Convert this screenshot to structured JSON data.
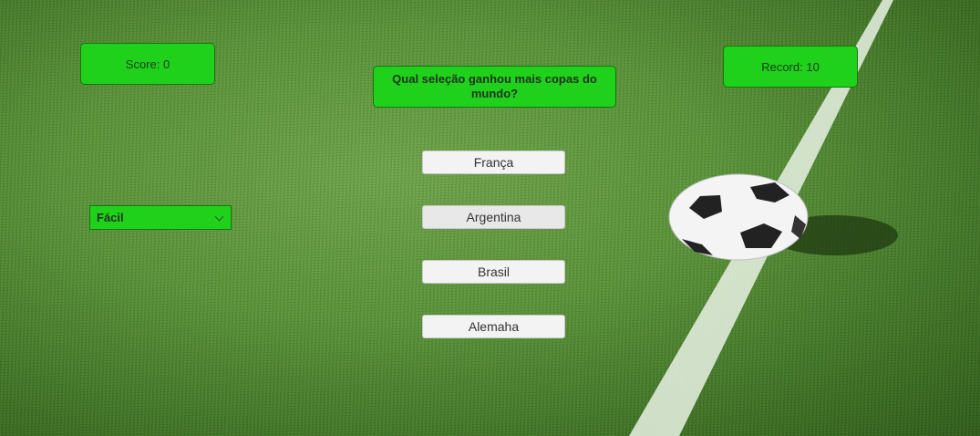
{
  "score_label": "Score: 0",
  "record_label": "Record: 10",
  "question": "Qual seleção ganhou mais copas do mundo?",
  "answers": [
    "França",
    "Argentina",
    "Brasil",
    "Alemaha"
  ],
  "difficulty": {
    "selected": "Fácil"
  },
  "colors": {
    "panel": "#1fd11a",
    "button": "#f3f3f3",
    "grass": "#5a9438"
  }
}
